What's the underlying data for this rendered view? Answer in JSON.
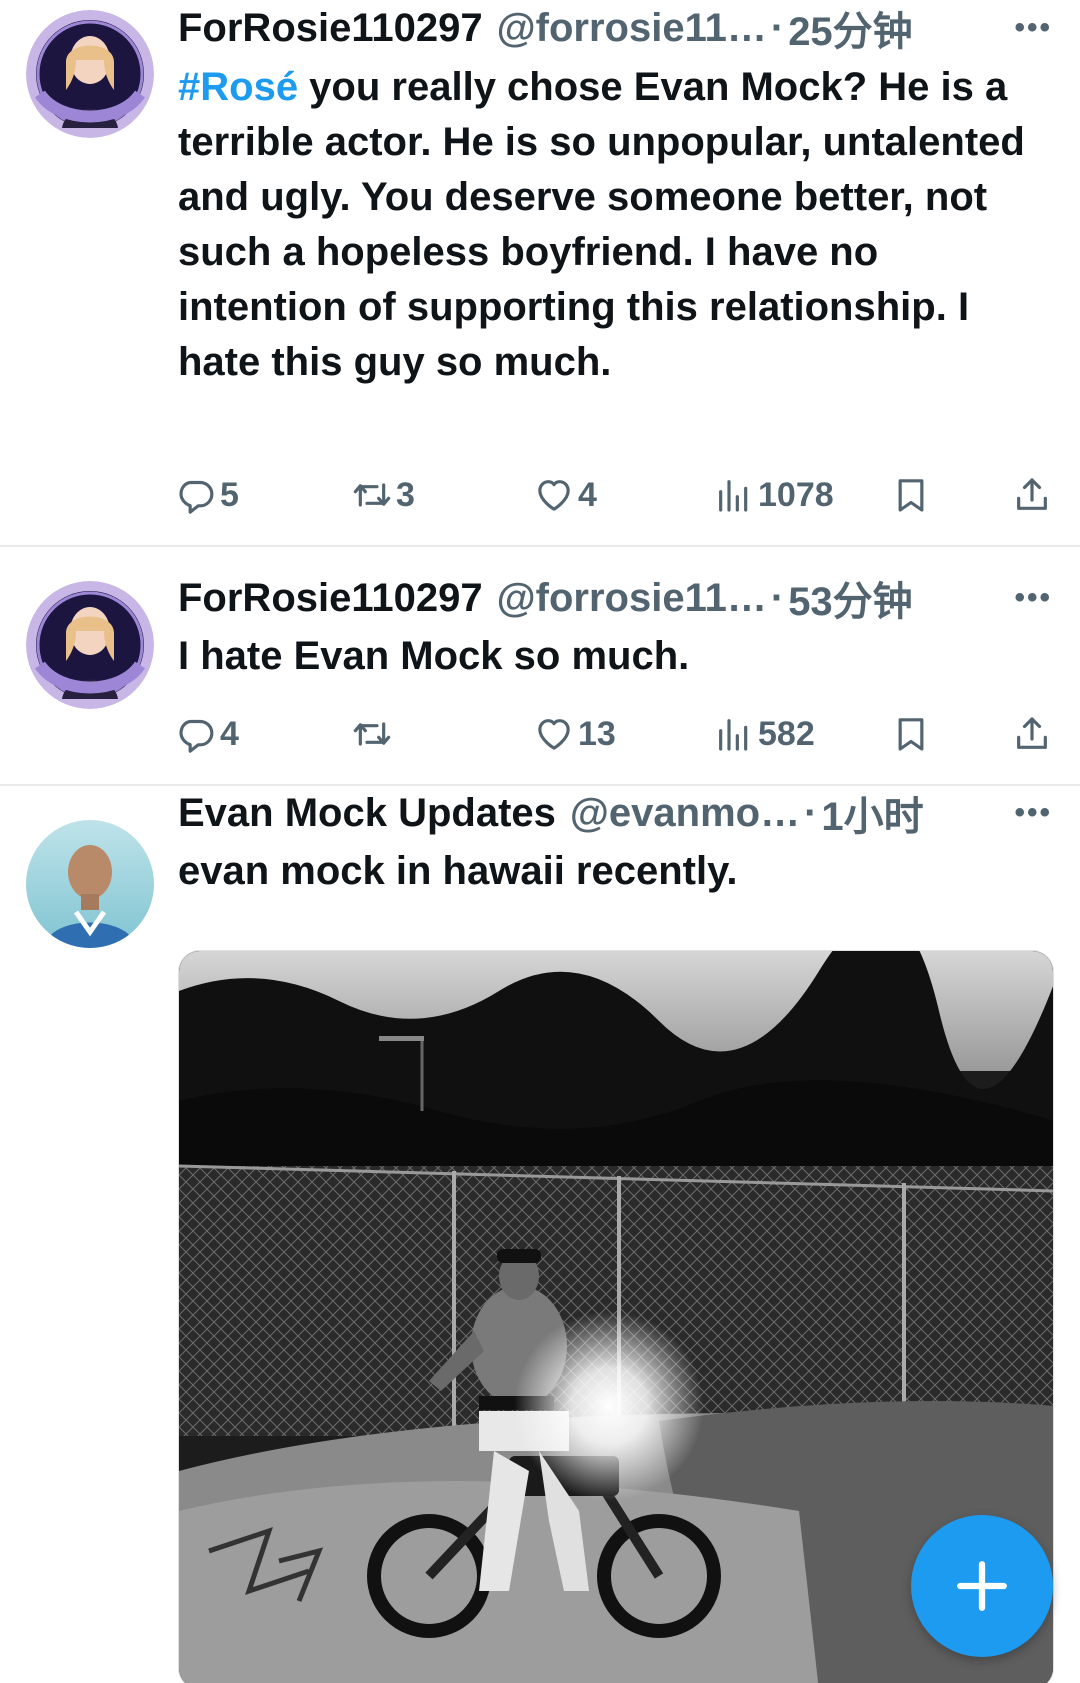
{
  "tweets": [
    {
      "name": "ForRosie110297",
      "handle": "@forrosie11…",
      "dot": "·",
      "time": "25分钟",
      "more": "•••",
      "hashtag": "#Rosé",
      "text": " you really chose Evan Mock? He is a terrible actor. He is so unpopular, untalented and ugly.  You deserve someone better, not such a hopeless boyfriend. I have no intention of supporting this relationship. I hate this guy so much.",
      "replies": "5",
      "retweets": "3",
      "likes": "4",
      "views": "1078"
    },
    {
      "name": "ForRosie110297",
      "handle": "@forrosie11…",
      "dot": "·",
      "time": "53分钟",
      "more": "•••",
      "text": "I hate Evan Mock so much.",
      "replies": "4",
      "retweets": "",
      "likes": "13",
      "views": "582"
    },
    {
      "name": "Evan Mock Updates",
      "handle": "@evanmo…",
      "dot": "·",
      "time": "1小时",
      "more": "•••",
      "text": "evan mock in hawaii recently."
    }
  ],
  "colors": {
    "accent": "#1d9bf0",
    "text": "#0f1419",
    "muted": "#536471",
    "divider": "#e7e9ea"
  },
  "icons": {
    "reply": "reply-icon",
    "retweet": "retweet-icon",
    "like": "heart-icon",
    "views": "views-icon",
    "bookmark": "bookmark-icon",
    "share": "share-icon",
    "compose": "plus-icon"
  }
}
